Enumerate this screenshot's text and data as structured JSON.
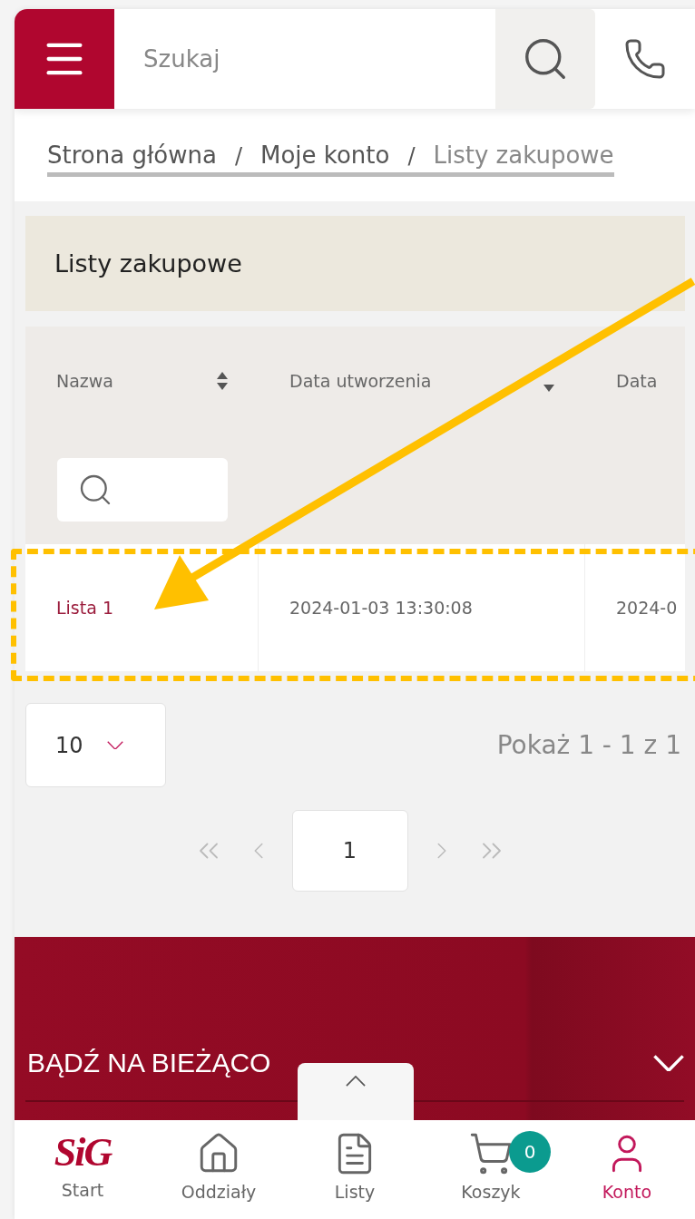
{
  "header": {
    "search": {
      "placeholder": "Szukaj"
    }
  },
  "breadcrumb": [
    {
      "label": "Strona główna",
      "current": false
    },
    {
      "label": "Moje konto",
      "current": false
    },
    {
      "label": "Listy zakupowe",
      "current": true
    }
  ],
  "breadcrumb_separator": "/",
  "page_title": "Listy zakupowe",
  "table": {
    "columns": [
      {
        "label": "Nazwa",
        "sorted_descending": false
      },
      {
        "label": "Data utworzenia",
        "sorted_descending": true
      },
      {
        "label": "Data"
      }
    ],
    "rows": [
      {
        "cells": [
          "Lista 1",
          "2024-01-03 13:30:08",
          "2024-0"
        ]
      }
    ]
  },
  "page_size": "10",
  "summary": "Pokaż 1 - 1 z 1",
  "pager": {
    "current": "1"
  },
  "footer": {
    "title": "BĄDŹ NA BIEŻĄCO",
    "expanded": false
  },
  "nav": [
    {
      "label": "Start",
      "kind": "logo",
      "logo": "SiG",
      "selected": false
    },
    {
      "label": "Oddziały",
      "kind": "home",
      "selected": false
    },
    {
      "label": "Listy",
      "kind": "document",
      "selected": false
    },
    {
      "label": "Koszyk",
      "kind": "cart",
      "badge": "0",
      "selected": false
    },
    {
      "label": "Konto",
      "kind": "user",
      "selected": true
    }
  ]
}
